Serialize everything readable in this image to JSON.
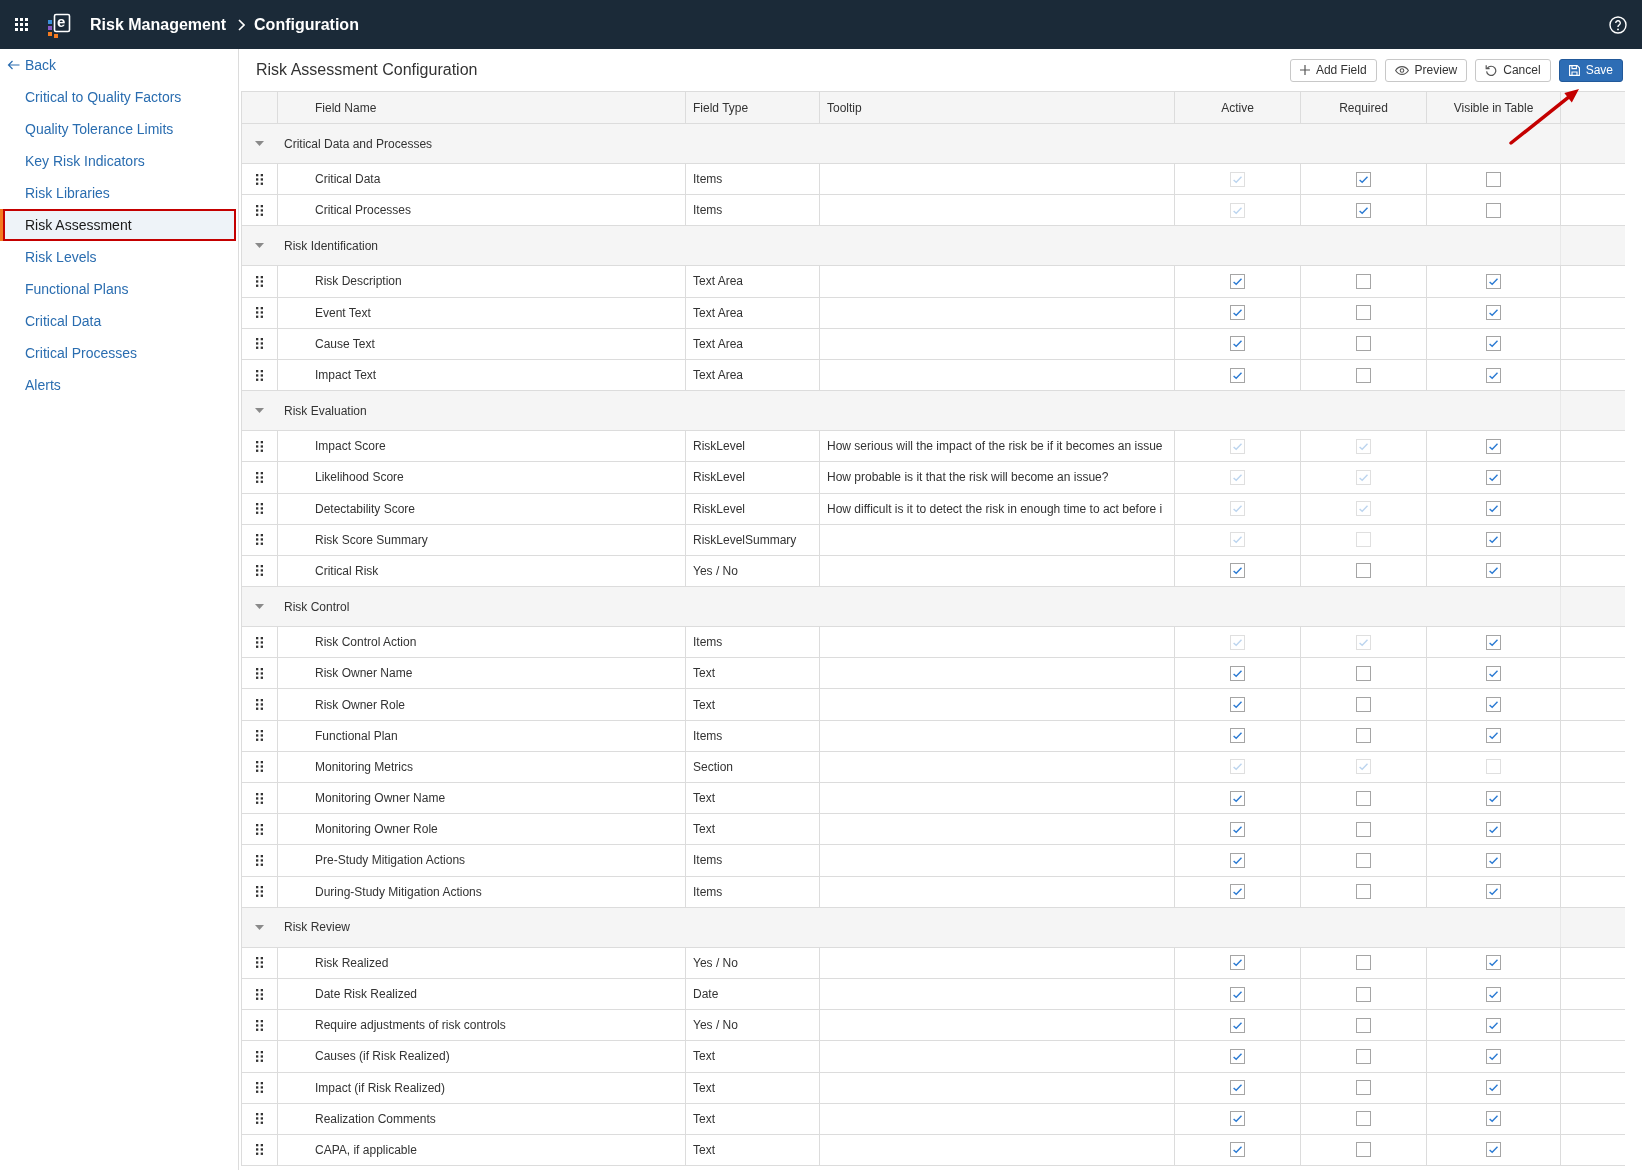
{
  "header": {
    "logo_letter": "e",
    "app_title": "Risk Management",
    "breadcrumb": "Configuration"
  },
  "sidebar": {
    "back": "Back",
    "items": [
      {
        "label": "Critical to Quality Factors",
        "selected": false,
        "highlighted": false
      },
      {
        "label": "Quality Tolerance Limits",
        "selected": false,
        "highlighted": false
      },
      {
        "label": "Key Risk Indicators",
        "selected": false,
        "highlighted": false
      },
      {
        "label": "Risk Libraries",
        "selected": false,
        "highlighted": false
      },
      {
        "label": "Risk Assessment",
        "selected": true,
        "highlighted": true
      },
      {
        "label": "Risk Levels",
        "selected": false,
        "highlighted": false
      },
      {
        "label": "Functional Plans",
        "selected": false,
        "highlighted": false
      },
      {
        "label": "Critical Data",
        "selected": false,
        "highlighted": false
      },
      {
        "label": "Critical Processes",
        "selected": false,
        "highlighted": false
      },
      {
        "label": "Alerts",
        "selected": false,
        "highlighted": false
      }
    ]
  },
  "page": {
    "title": "Risk Assessment Configuration",
    "buttons": [
      {
        "label": "Add Field",
        "kind": "add"
      },
      {
        "label": "Preview",
        "kind": "preview"
      },
      {
        "label": "Cancel",
        "kind": "cancel"
      },
      {
        "label": "Save",
        "kind": "save"
      }
    ]
  },
  "table": {
    "columns": [
      "Field Name",
      "Field Type",
      "Tooltip",
      "Active",
      "Required",
      "Visible in Table"
    ],
    "groups": [
      {
        "name": "Critical Data and Processes",
        "expanded": true,
        "rows": [
          {
            "field_name": "Critical Data",
            "field_type": "Items",
            "active": {
              "checked": true,
              "disabled": true
            },
            "required": {
              "checked": true,
              "disabled": false
            },
            "visible_in_table": {
              "checked": false,
              "disabled": false
            }
          },
          {
            "field_name": "Critical Processes",
            "field_type": "Items",
            "active": {
              "checked": true,
              "disabled": true
            },
            "required": {
              "checked": true,
              "disabled": false
            },
            "visible_in_table": {
              "checked": false,
              "disabled": false
            }
          }
        ]
      },
      {
        "name": "Risk Identification",
        "expanded": true,
        "rows": [
          {
            "field_name": "Risk Description",
            "field_type": "Text Area",
            "active": {
              "checked": true,
              "disabled": false
            },
            "required": {
              "checked": false,
              "disabled": false
            },
            "visible_in_table": {
              "checked": true,
              "disabled": false
            }
          },
          {
            "field_name": "Event Text",
            "field_type": "Text Area",
            "active": {
              "checked": true,
              "disabled": false
            },
            "required": {
              "checked": false,
              "disabled": false
            },
            "visible_in_table": {
              "checked": true,
              "disabled": false
            }
          },
          {
            "field_name": "Cause Text",
            "field_type": "Text Area",
            "active": {
              "checked": true,
              "disabled": false
            },
            "required": {
              "checked": false,
              "disabled": false
            },
            "visible_in_table": {
              "checked": true,
              "disabled": false
            }
          },
          {
            "field_name": "Impact Text",
            "field_type": "Text Area",
            "active": {
              "checked": true,
              "disabled": false
            },
            "required": {
              "checked": false,
              "disabled": false
            },
            "visible_in_table": {
              "checked": true,
              "disabled": false
            }
          }
        ]
      },
      {
        "name": "Risk Evaluation",
        "expanded": true,
        "rows": [
          {
            "field_name": "Impact Score",
            "field_type": "RiskLevel",
            "tooltip": "How serious will the impact of the risk be if it becomes an issue",
            "active": {
              "checked": true,
              "disabled": true
            },
            "required": {
              "checked": true,
              "disabled": true
            },
            "visible_in_table": {
              "checked": true,
              "disabled": false
            }
          },
          {
            "field_name": "Likelihood Score",
            "field_type": "RiskLevel",
            "tooltip": "How probable is it that the risk will become an issue?",
            "active": {
              "checked": true,
              "disabled": true
            },
            "required": {
              "checked": true,
              "disabled": true
            },
            "visible_in_table": {
              "checked": true,
              "disabled": false
            }
          },
          {
            "field_name": "Detectability Score",
            "field_type": "RiskLevel",
            "tooltip": "How difficult is it to detect the risk in enough time to act before i",
            "active": {
              "checked": true,
              "disabled": true
            },
            "required": {
              "checked": true,
              "disabled": true
            },
            "visible_in_table": {
              "checked": true,
              "disabled": false
            }
          },
          {
            "field_name": "Risk Score Summary",
            "field_type": "RiskLevelSummary",
            "active": {
              "checked": true,
              "disabled": true
            },
            "required": {
              "checked": false,
              "disabled": true
            },
            "visible_in_table": {
              "checked": true,
              "disabled": false
            }
          },
          {
            "field_name": "Critical Risk",
            "field_type": "Yes / No",
            "active": {
              "checked": true,
              "disabled": false
            },
            "required": {
              "checked": false,
              "disabled": false
            },
            "visible_in_table": {
              "checked": true,
              "disabled": false
            }
          }
        ]
      },
      {
        "name": "Risk Control",
        "expanded": true,
        "rows": [
          {
            "field_name": "Risk Control Action",
            "field_type": "Items",
            "active": {
              "checked": true,
              "disabled": true
            },
            "required": {
              "checked": true,
              "disabled": true
            },
            "visible_in_table": {
              "checked": true,
              "disabled": false
            }
          },
          {
            "field_name": "Risk Owner Name",
            "field_type": "Text",
            "active": {
              "checked": true,
              "disabled": false
            },
            "required": {
              "checked": false,
              "disabled": false
            },
            "visible_in_table": {
              "checked": true,
              "disabled": false
            }
          },
          {
            "field_name": "Risk Owner Role",
            "field_type": "Text",
            "active": {
              "checked": true,
              "disabled": false
            },
            "required": {
              "checked": false,
              "disabled": false
            },
            "visible_in_table": {
              "checked": true,
              "disabled": false
            }
          },
          {
            "field_name": "Functional Plan",
            "field_type": "Items",
            "active": {
              "checked": true,
              "disabled": false
            },
            "required": {
              "checked": false,
              "disabled": false
            },
            "visible_in_table": {
              "checked": true,
              "disabled": false
            }
          },
          {
            "field_name": "Monitoring Metrics",
            "field_type": "Section",
            "active": {
              "checked": true,
              "disabled": true
            },
            "required": {
              "checked": true,
              "disabled": true
            },
            "visible_in_table": {
              "checked": false,
              "disabled": true
            }
          },
          {
            "field_name": "Monitoring Owner Name",
            "field_type": "Text",
            "active": {
              "checked": true,
              "disabled": false
            },
            "required": {
              "checked": false,
              "disabled": false
            },
            "visible_in_table": {
              "checked": true,
              "disabled": false
            }
          },
          {
            "field_name": "Monitoring Owner Role",
            "field_type": "Text",
            "active": {
              "checked": true,
              "disabled": false
            },
            "required": {
              "checked": false,
              "disabled": false
            },
            "visible_in_table": {
              "checked": true,
              "disabled": false
            }
          },
          {
            "field_name": "Pre-Study Mitigation Actions",
            "field_type": "Items",
            "active": {
              "checked": true,
              "disabled": false
            },
            "required": {
              "checked": false,
              "disabled": false
            },
            "visible_in_table": {
              "checked": true,
              "disabled": false
            }
          },
          {
            "field_name": "During-Study Mitigation Actions",
            "field_type": "Items",
            "active": {
              "checked": true,
              "disabled": false
            },
            "required": {
              "checked": false,
              "disabled": false
            },
            "visible_in_table": {
              "checked": true,
              "disabled": false
            }
          }
        ]
      },
      {
        "name": "Risk Review",
        "expanded": true,
        "rows": [
          {
            "field_name": "Risk Realized",
            "field_type": "Yes / No",
            "active": {
              "checked": true,
              "disabled": false
            },
            "required": {
              "checked": false,
              "disabled": false
            },
            "visible_in_table": {
              "checked": true,
              "disabled": false
            }
          },
          {
            "field_name": "Date Risk Realized",
            "field_type": "Date",
            "active": {
              "checked": true,
              "disabled": false
            },
            "required": {
              "checked": false,
              "disabled": false
            },
            "visible_in_table": {
              "checked": true,
              "disabled": false
            }
          },
          {
            "field_name": "Require adjustments of risk controls",
            "field_type": "Yes / No",
            "active": {
              "checked": true,
              "disabled": false
            },
            "required": {
              "checked": false,
              "disabled": false
            },
            "visible_in_table": {
              "checked": true,
              "disabled": false
            }
          },
          {
            "field_name": "Causes (if Risk Realized)",
            "field_type": "Text",
            "active": {
              "checked": true,
              "disabled": false
            },
            "required": {
              "checked": false,
              "disabled": false
            },
            "visible_in_table": {
              "checked": true,
              "disabled": false
            }
          },
          {
            "field_name": "Impact (if Risk Realized)",
            "field_type": "Text",
            "active": {
              "checked": true,
              "disabled": false
            },
            "required": {
              "checked": false,
              "disabled": false
            },
            "visible_in_table": {
              "checked": true,
              "disabled": false
            }
          },
          {
            "field_name": "Realization Comments",
            "field_type": "Text",
            "active": {
              "checked": true,
              "disabled": false
            },
            "required": {
              "checked": false,
              "disabled": false
            },
            "visible_in_table": {
              "checked": true,
              "disabled": false
            }
          },
          {
            "field_name": "CAPA, if applicable",
            "field_type": "Text",
            "active": {
              "checked": true,
              "disabled": false
            },
            "required": {
              "checked": false,
              "disabled": false
            },
            "visible_in_table": {
              "checked": true,
              "disabled": false
            }
          }
        ]
      }
    ]
  }
}
